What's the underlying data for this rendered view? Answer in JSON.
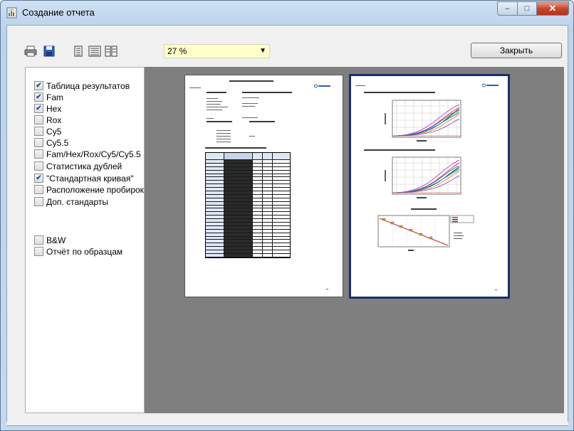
{
  "window": {
    "title": "Создание отчета",
    "controls": {
      "minimize": "–",
      "maximize": "□",
      "close": "✕"
    }
  },
  "toolbar": {
    "icons": [
      "print-icon",
      "save-icon",
      "layout-single-icon",
      "layout-wide-icon",
      "layout-two-page-icon"
    ],
    "zoom_value": "27 %",
    "close_label": "Закрыть"
  },
  "options": {
    "items": [
      {
        "label": "Таблица результатов",
        "checked": true
      },
      {
        "label": "Fam",
        "checked": true
      },
      {
        "label": "Hex",
        "checked": true
      },
      {
        "label": "Rox",
        "checked": false
      },
      {
        "label": "Cy5",
        "checked": false
      },
      {
        "label": "Cy5.5",
        "checked": false
      },
      {
        "label": "Fam/Hex/Rox/Cy5/Cy5.5",
        "checked": false
      },
      {
        "label": "Статистика дублей",
        "checked": false
      },
      {
        "label": "\"Стандартная кривая\"",
        "checked": true
      },
      {
        "label": "Расположение пробирок",
        "checked": false
      },
      {
        "label": "Доп. стандарты",
        "checked": false
      }
    ],
    "extra": [
      {
        "label": "B&W",
        "checked": false
      },
      {
        "label": "Отчёт по образцам",
        "checked": false
      }
    ]
  },
  "colors": {
    "preview_bg": "#7f7f7f",
    "selected_page_border": "#1a2f6b",
    "zoom_bg": "#ffffc8",
    "check_color": "#1f4f9c"
  }
}
